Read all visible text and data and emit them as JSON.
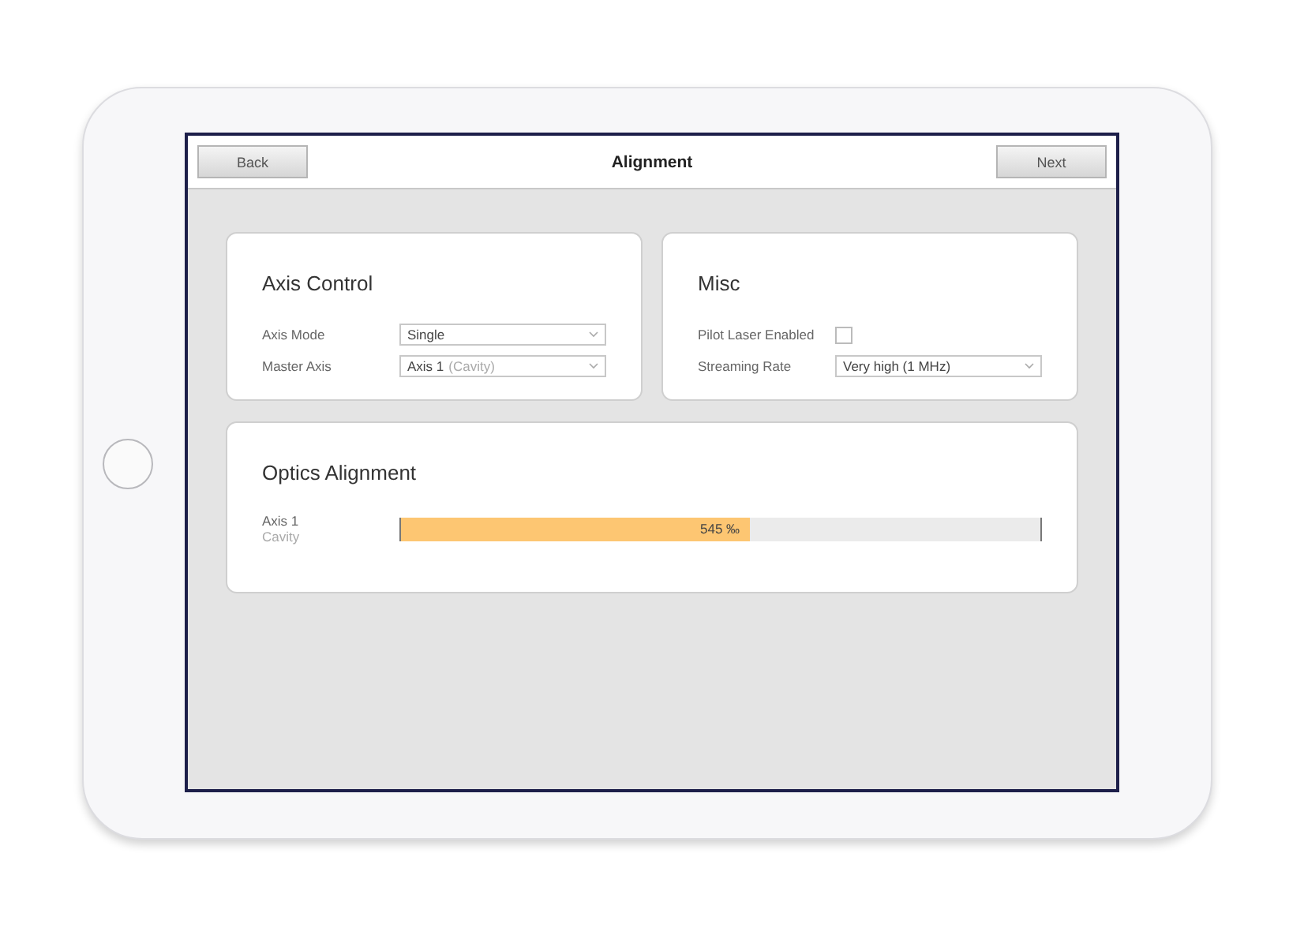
{
  "header": {
    "back": "Back",
    "title": "Alignment",
    "next": "Next"
  },
  "cards": [
    {
      "title": "Axis Control",
      "rows": [
        {
          "kind": "select",
          "label": "Axis Mode",
          "value": "Single"
        },
        {
          "kind": "select",
          "label": "Master Axis",
          "value": "Axis 1",
          "detail": "(Cavity)"
        }
      ]
    },
    {
      "title": "Misc",
      "rows": [
        {
          "kind": "checkbox",
          "label": "Pilot Laser Enabled",
          "checked": false
        },
        {
          "kind": "select",
          "label": "Streaming Rate",
          "value": "Very high (1 MHz)"
        }
      ]
    }
  ],
  "optics": {
    "title": "Optics Alignment",
    "channels": [
      {
        "name": "Axis 1",
        "detail": "Cavity",
        "level": 0.545,
        "reading": "545 ‰"
      }
    ]
  }
}
